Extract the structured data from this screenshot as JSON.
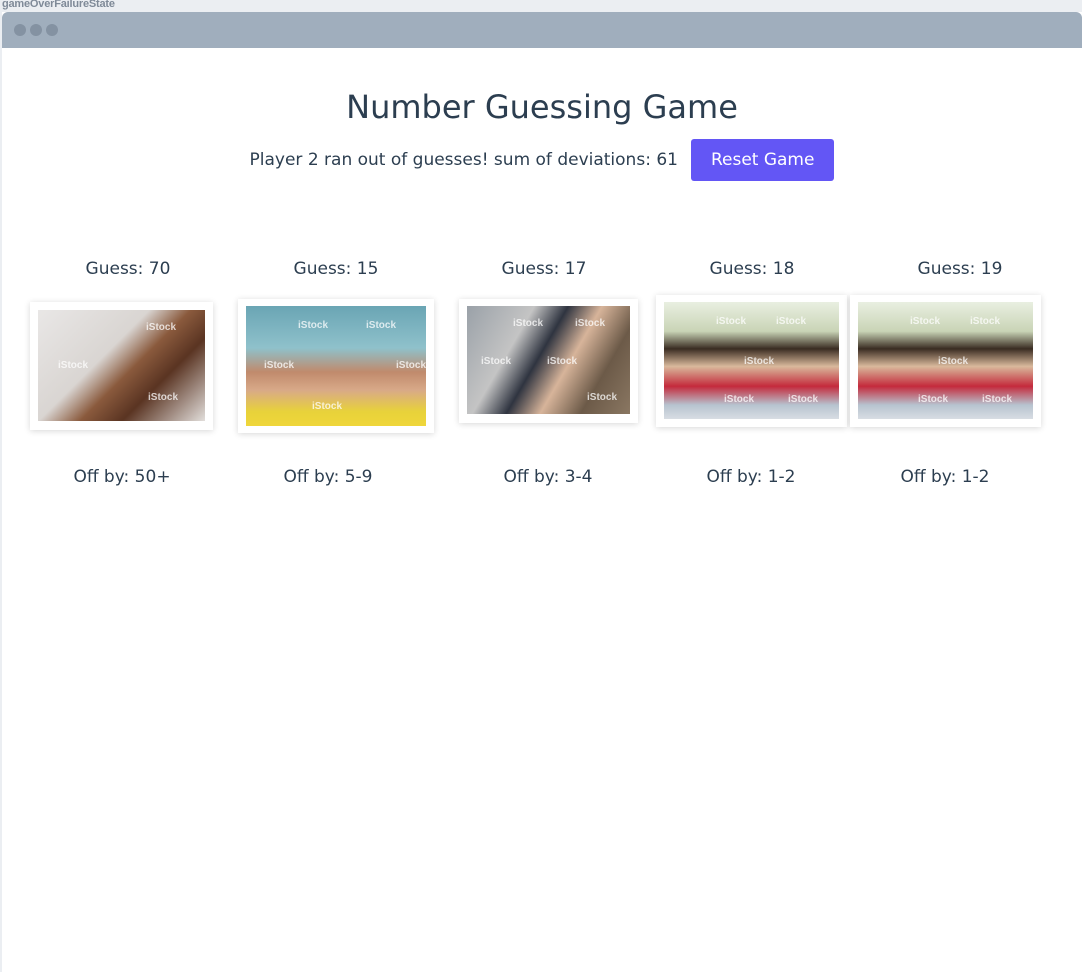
{
  "story": {
    "name": "gameOverFailureState"
  },
  "game": {
    "title": "Number Guessing Game",
    "status": "Player 2 ran out of guesses! sum of deviations: 61",
    "reset_label": "Reset Game"
  },
  "guesses": [
    {
      "guess": "Guess: 70",
      "off_by": "Off by: 50+",
      "image": "crying-baby-photo",
      "watermark": "iStock"
    },
    {
      "guess": "Guess: 15",
      "off_by": "Off by: 5-9",
      "image": "crying-toddler-photo",
      "watermark": "iStock"
    },
    {
      "guess": "Guess: 17",
      "off_by": "Off by: 3-4",
      "image": "parent-holding-baby-photo",
      "watermark": "iStock"
    },
    {
      "guess": "Guess: 18",
      "off_by": "Off by: 1-2",
      "image": "girl-covering-face-photo",
      "watermark": "iStock"
    },
    {
      "guess": "Guess: 19",
      "off_by": "Off by: 1-2",
      "image": "girl-covering-face-photo",
      "watermark": "iStock"
    }
  ],
  "colors": {
    "accent": "#6356f5",
    "text": "#2c3e50",
    "titlebar": "#a0aebd"
  }
}
